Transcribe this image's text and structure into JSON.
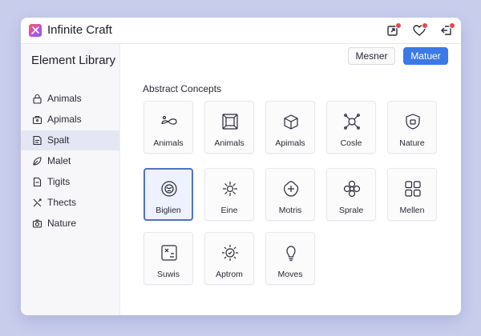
{
  "app": {
    "title": "Infinite Craft"
  },
  "sidebar": {
    "title": "Element Library",
    "items": [
      {
        "label": "Animals",
        "icon": "lock-icon",
        "active": false
      },
      {
        "label": "Apimals",
        "icon": "briefcase-icon",
        "active": false
      },
      {
        "label": "Spalt",
        "icon": "document-icon",
        "active": true
      },
      {
        "label": "Malet",
        "icon": "leaf-icon",
        "active": false
      },
      {
        "label": "Tigits",
        "icon": "page-icon",
        "active": false
      },
      {
        "label": "Thects",
        "icon": "tools-icon",
        "active": false
      },
      {
        "label": "Nature",
        "icon": "camera-icon",
        "active": false
      }
    ]
  },
  "toolbar": {
    "secondary_label": "Mesner",
    "primary_label": "Matuer"
  },
  "section": {
    "title": "Abstract Concepts"
  },
  "cards": [
    {
      "label": "Animals",
      "icon": "infinity-icon"
    },
    {
      "label": "Animals",
      "icon": "frame-icon"
    },
    {
      "label": "Apimals",
      "icon": "cube-icon"
    },
    {
      "label": "Cosle",
      "icon": "network-icon"
    },
    {
      "label": "Nature",
      "icon": "shield-icon"
    },
    {
      "label": "Biglien",
      "icon": "globe-icon",
      "selected": true
    },
    {
      "label": "Eine",
      "icon": "burst-icon"
    },
    {
      "label": "Motris",
      "icon": "plus-flower-icon"
    },
    {
      "label": "Sprale",
      "icon": "flower-icon"
    },
    {
      "label": "Mellen",
      "icon": "grid-icon"
    },
    {
      "label": "Suwis",
      "icon": "dice-icon"
    },
    {
      "label": "Aptrom",
      "icon": "sun-icon"
    },
    {
      "label": "Moves",
      "icon": "bulb-icon"
    }
  ],
  "colors": {
    "accent": "#3b79e8",
    "selected_border": "#4f72c9",
    "badge": "#e5484d",
    "background": "#c8cdec"
  }
}
